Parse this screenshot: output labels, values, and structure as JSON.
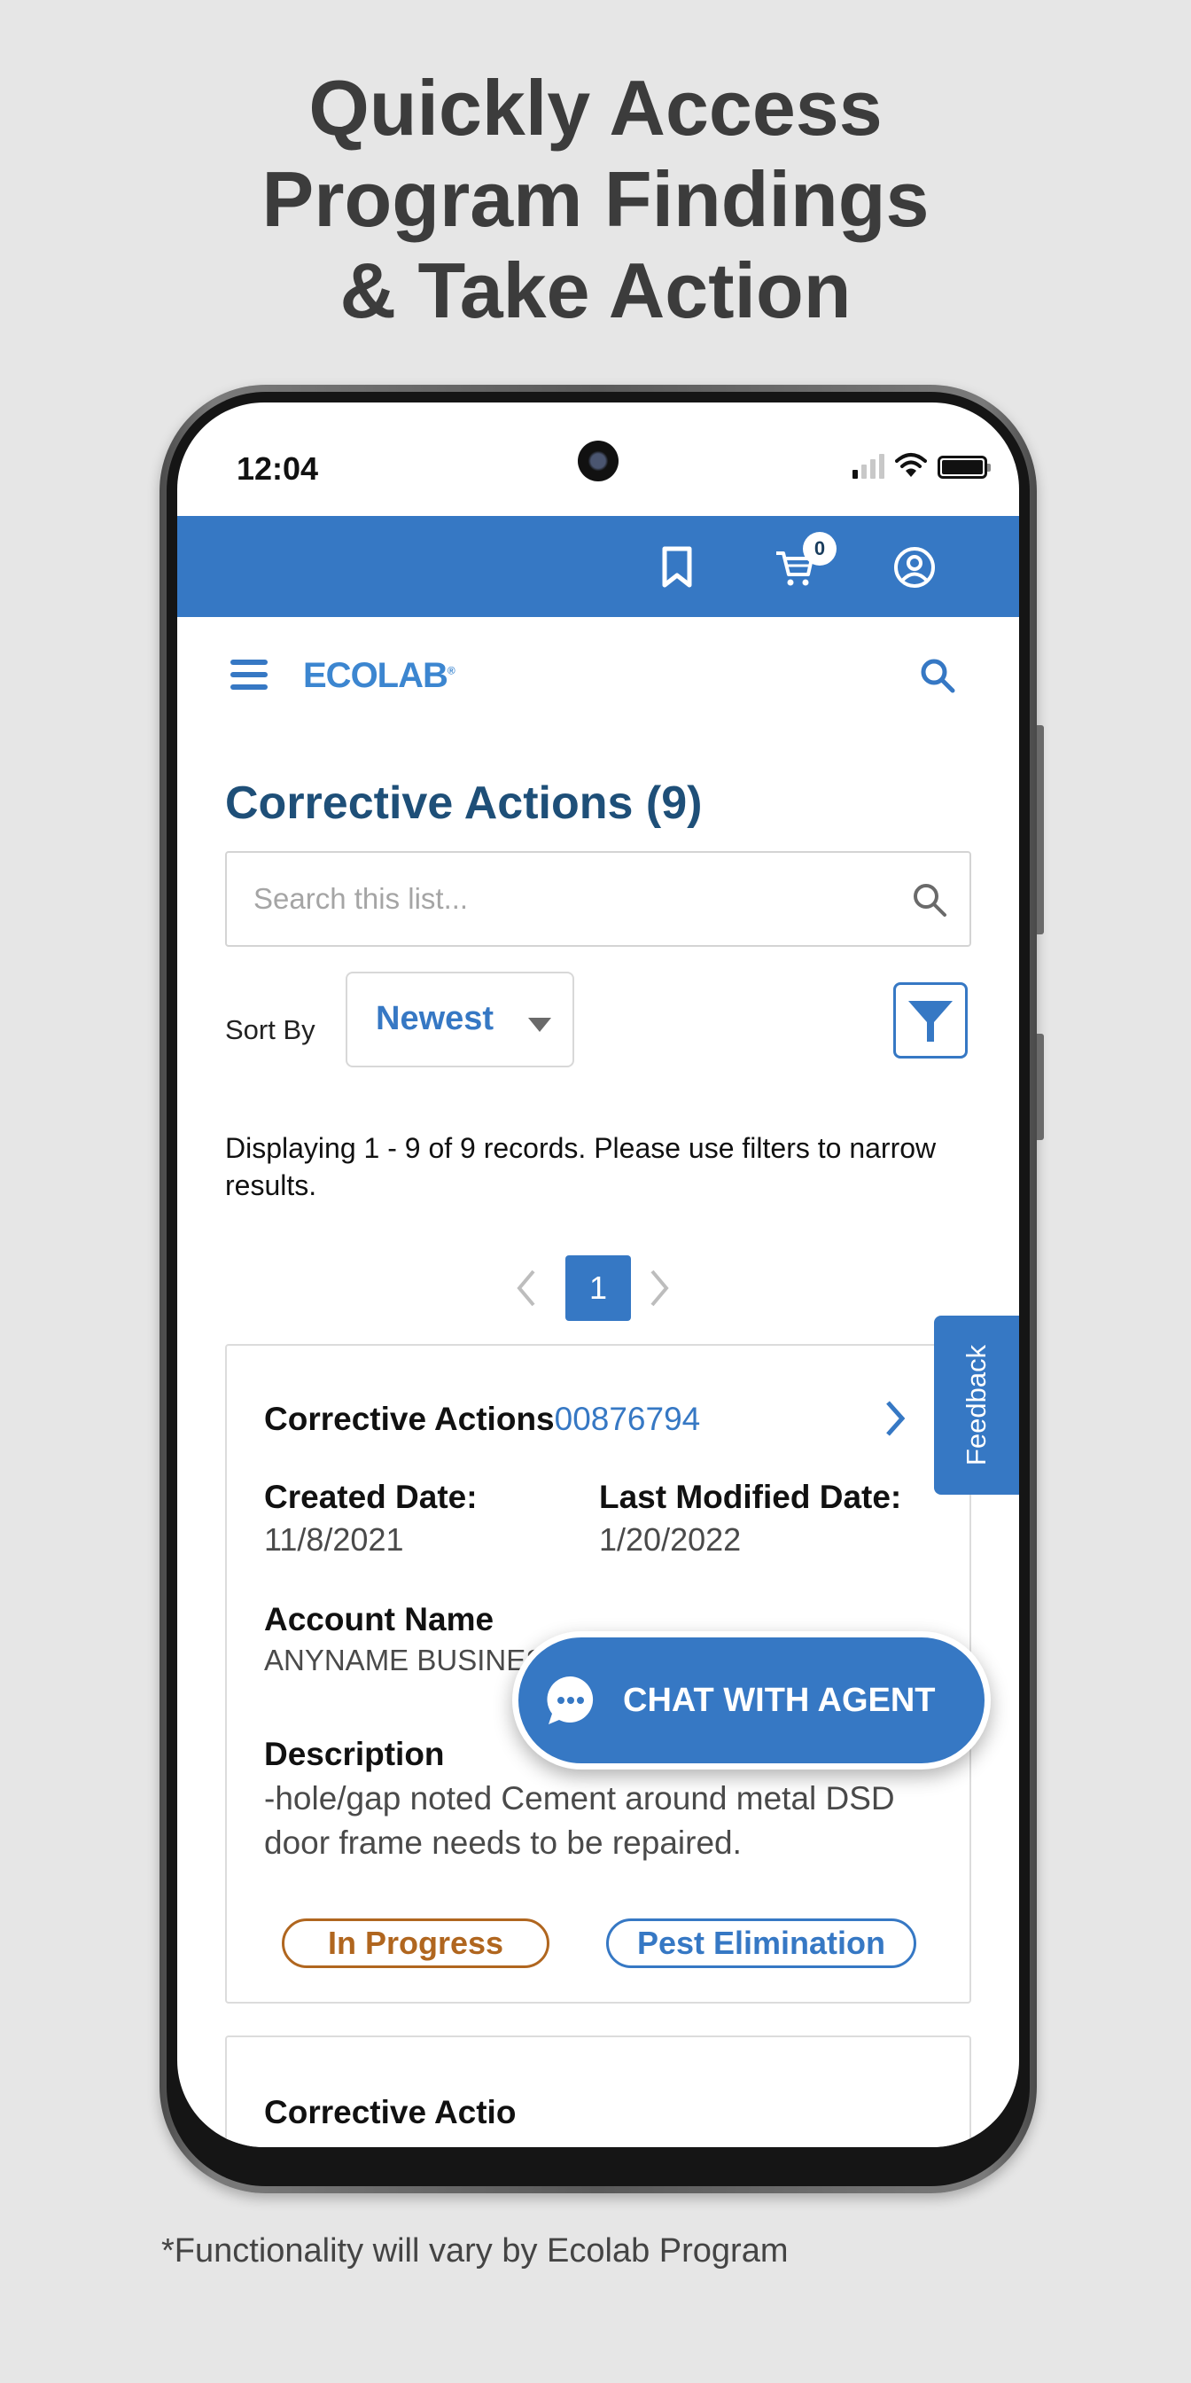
{
  "promo": {
    "headline_lines": [
      "Quickly Access",
      "Program Findings",
      "& Take Action"
    ],
    "footnote": "*Functionality will vary by Ecolab Program"
  },
  "status_bar": {
    "time": "12:04",
    "signal_bars_active": 1,
    "signal_bars_total": 4
  },
  "app_header": {
    "icons": [
      "bookmark-icon",
      "cart-icon",
      "account-icon"
    ],
    "cart_count": "0",
    "brand_color": "#3678c4"
  },
  "nav": {
    "logo_text": "ECOLAB",
    "logo_mark": "®"
  },
  "page": {
    "title": "Corrective Actions (9)",
    "search_placeholder": "Search this list...",
    "search_value": "",
    "sort_label": "Sort By",
    "sort_value": "Newest",
    "records_text": "Displaying 1 - 9 of 9 records. Please use filters to narrow results.",
    "pagination": {
      "current_page": "1"
    }
  },
  "records": [
    {
      "title_prefix": "Corrective Actions",
      "id": "00876794",
      "created_label": "Created Date:",
      "created_value": "11/8/2021",
      "modified_label": "Last Modified Date:",
      "modified_value": "1/20/2022",
      "account_label": "Account Name",
      "account_value": "ANYNAME BUSINESS",
      "description_label": "Description",
      "description_value": "-hole/gap noted Cement around metal DSD door frame needs to be repaired.",
      "status": "In Progress",
      "status_color": "#b0661f",
      "category": "Pest Elimination",
      "category_color": "#3678c4"
    },
    {
      "title_prefix": "Corrective Actio"
    }
  ],
  "feedback_label": "Feedback",
  "chat": {
    "label": "CHAT WITH AGENT"
  }
}
